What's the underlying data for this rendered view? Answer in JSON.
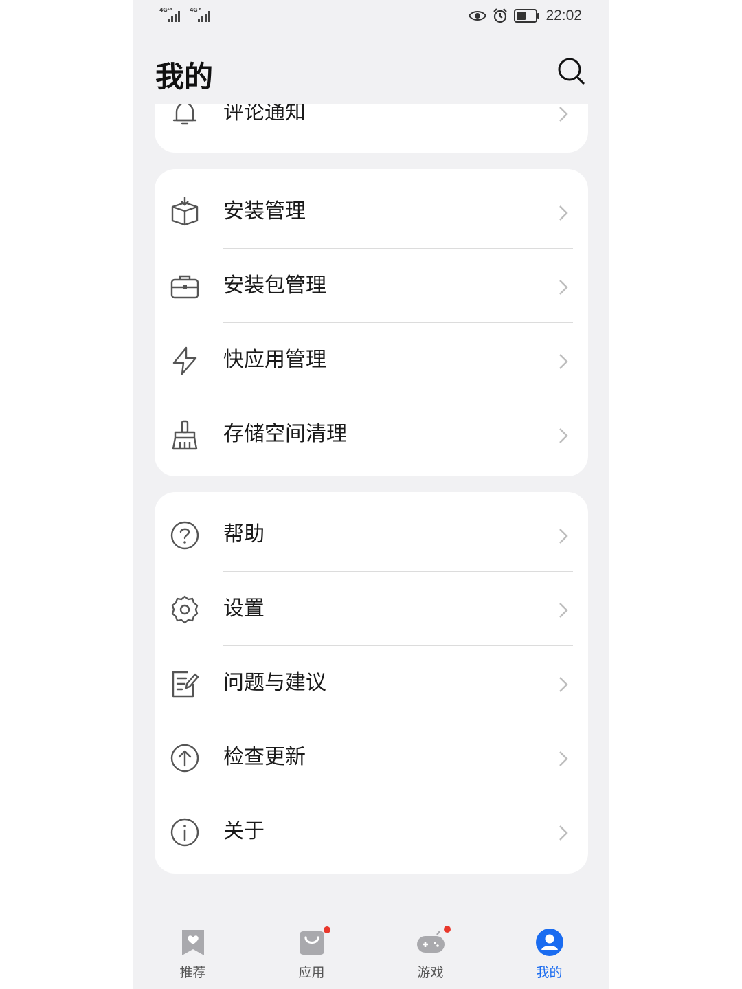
{
  "status_bar": {
    "signal1_label": "4G⁺ᴿ",
    "signal2_label": "4G ᴿ",
    "time": "22:02"
  },
  "header": {
    "title": "我的"
  },
  "menu": {
    "card0": [
      {
        "label": "评论通知",
        "icon": "bell-icon"
      }
    ],
    "card1": [
      {
        "label": "安装管理",
        "icon": "install-box-icon"
      },
      {
        "label": "安装包管理",
        "icon": "briefcase-icon"
      },
      {
        "label": "快应用管理",
        "icon": "lightning-icon"
      },
      {
        "label": "存储空间清理",
        "icon": "broom-icon"
      }
    ],
    "card2": [
      {
        "label": "帮助",
        "icon": "help-circle-icon"
      },
      {
        "label": "设置",
        "icon": "gear-icon"
      },
      {
        "label": "问题与建议",
        "icon": "feedback-edit-icon"
      },
      {
        "label": "检查更新",
        "icon": "arrow-up-circle-icon"
      },
      {
        "label": "关于",
        "icon": "info-circle-icon"
      }
    ]
  },
  "tabbar": {
    "tabs": [
      {
        "label": "推荐",
        "icon": "bookmark-heart-icon"
      },
      {
        "label": "应用",
        "icon": "shopping-bag-icon"
      },
      {
        "label": "游戏",
        "icon": "gamepad-icon"
      },
      {
        "label": "我的",
        "icon": "user-avatar-icon"
      }
    ]
  },
  "colors": {
    "accent": "#1a6cf0",
    "badge": "#e9382c",
    "background": "#f1f1f3",
    "card": "#ffffff"
  }
}
